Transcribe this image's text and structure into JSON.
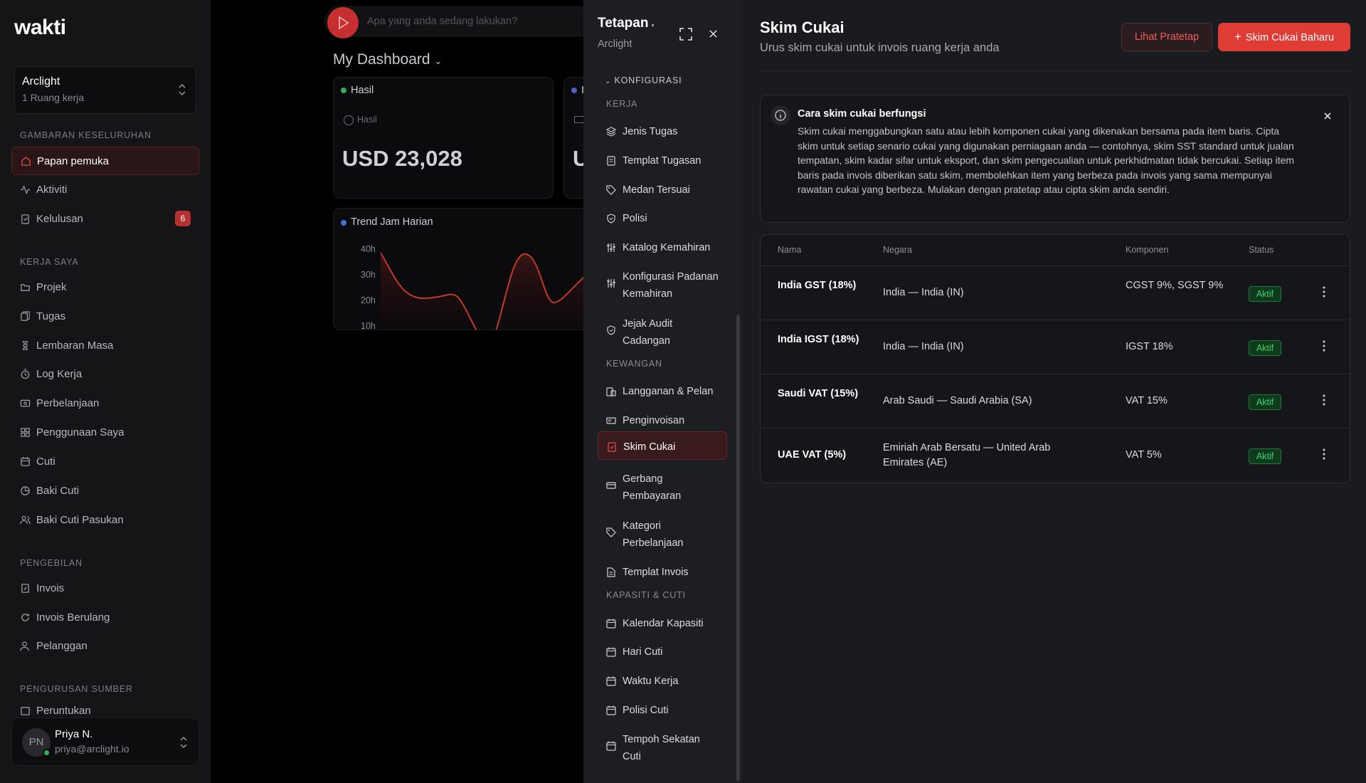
{
  "brand": {
    "logo": "wakti"
  },
  "workspace": {
    "name": "Arclight",
    "count": "1 Ruang kerja"
  },
  "sidebar": {
    "sections": [
      {
        "title": "GAMBARAN KESELURUHAN",
        "items": [
          {
            "label": "Papan pemuka",
            "icon": "home-icon",
            "active": true
          },
          {
            "label": "Aktiviti",
            "icon": "activity-icon"
          },
          {
            "label": "Kelulusan",
            "icon": "clipboard-icon",
            "badge": "6"
          }
        ]
      },
      {
        "title": "KERJA SAYA",
        "items": [
          {
            "label": "Projek",
            "icon": "folder-icon"
          },
          {
            "label": "Tugas",
            "icon": "checklist-icon"
          },
          {
            "label": "Lembaran Masa",
            "icon": "hourglass-icon"
          },
          {
            "label": "Log Kerja",
            "icon": "timer-icon"
          },
          {
            "label": "Perbelanjaan",
            "icon": "wallet-icon"
          },
          {
            "label": "Penggunaan Saya",
            "icon": "grid-icon"
          },
          {
            "label": "Cuti",
            "icon": "calendar-icon"
          },
          {
            "label": "Baki Cuti",
            "icon": "pie-icon"
          },
          {
            "label": "Baki Cuti Pasukan",
            "icon": "users-icon"
          }
        ]
      },
      {
        "title": "PENGEBILAN",
        "items": [
          {
            "label": "Invois",
            "icon": "invoice-icon"
          },
          {
            "label": "Invois Berulang",
            "icon": "repeat-icon"
          },
          {
            "label": "Pelanggan",
            "icon": "user-icon"
          }
        ]
      },
      {
        "title": "PENGURUSAN SUMBER",
        "items": [
          {
            "label": "Peruntukan",
            "icon": "allocation-icon"
          }
        ]
      }
    ]
  },
  "user": {
    "initials": "PN",
    "name": "Priya N.",
    "email": "priya@arclight.io"
  },
  "dashboard": {
    "search_placeholder": "Apa yang anda sedang lakukan?",
    "title": "My Dashboard",
    "card1": {
      "header": "Hasil",
      "sub": "Hasil",
      "value": "USD 23,028"
    },
    "card2": {
      "header": "I",
      "value": "U"
    },
    "trend": {
      "title": "Trend Jam Harian",
      "ticks": [
        "40h",
        "30h",
        "20h",
        "10h"
      ]
    }
  },
  "settings_nav": {
    "title": "Tetapan",
    "subtitle": "Arclight",
    "config_label": "KONFIGURASI",
    "groups": [
      {
        "title": "KERJA",
        "items": [
          {
            "label": "Jenis Tugas",
            "icon": "layers-icon"
          },
          {
            "label": "Templat Tugasan",
            "icon": "template-icon"
          },
          {
            "label": "Medan Tersuai",
            "icon": "tag-icon"
          },
          {
            "label": "Polisi",
            "icon": "shield-icon"
          },
          {
            "label": "Katalog Kemahiran",
            "icon": "sliders-icon"
          },
          {
            "label": "Konfigurasi Padanan Kemahiran",
            "icon": "sliders-icon"
          },
          {
            "label": "Jejak Audit Cadangan",
            "icon": "shield-check-icon"
          }
        ]
      },
      {
        "title": "KEWANGAN",
        "items": [
          {
            "label": "Langganan & Pelan",
            "icon": "subscription-icon"
          },
          {
            "label": "Penginvoisan",
            "icon": "invoice-icon"
          },
          {
            "label": "Skim Cukai",
            "icon": "tax-icon",
            "active": true
          },
          {
            "label": "Gerbang Pembayaran",
            "icon": "card-icon"
          },
          {
            "label": "Kategori Perbelanjaan",
            "icon": "tag-icon"
          },
          {
            "label": "Templat Invois",
            "icon": "document-icon"
          }
        ]
      },
      {
        "title": "KAPASITI & CUTI",
        "items": [
          {
            "label": "Kalendar Kapasiti",
            "icon": "calendar-icon"
          },
          {
            "label": "Hari Cuti",
            "icon": "calendar-icon"
          },
          {
            "label": "Waktu Kerja",
            "icon": "calendar-icon"
          },
          {
            "label": "Polisi Cuti",
            "icon": "calendar-icon"
          },
          {
            "label": "Tempoh Sekatan Cuti",
            "icon": "calendar-icon"
          }
        ]
      }
    ]
  },
  "main": {
    "title": "Skim Cukai",
    "subtitle": "Urus skim cukai untuk invois ruang kerja anda",
    "btn_presets": "Lihat Pratetap",
    "btn_new": "Skim Cukai Baharu",
    "info": {
      "title": "Cara skim cukai berfungsi",
      "body": "Skim cukai menggabungkan satu atau lebih komponen cukai yang dikenakan bersama pada item baris. Cipta skim untuk setiap senario cukai yang digunakan perniagaan anda — contohnya, skim SST standard untuk jualan tempatan, skim kadar sifar untuk eksport, dan skim pengecualian untuk perkhidmatan tidak bercukai. Setiap item baris pada invois diberikan satu skim, membolehkan item yang berbeza pada invois yang sama mempunyai rawatan cukai yang berbeza. Mulakan dengan pratetap atau cipta skim anda sendiri."
    },
    "table": {
      "headers": [
        "Nama",
        "Negara",
        "Komponen",
        "Status"
      ],
      "rows": [
        {
          "name": "India GST (18%)",
          "country": "India — India (IN)",
          "components": "CGST 9%, SGST 9%",
          "status": "Aktif"
        },
        {
          "name": "India IGST (18%)",
          "country": "India — India (IN)",
          "components": "IGST 18%",
          "status": "Aktif"
        },
        {
          "name": "Saudi VAT (15%)",
          "country": "Arab Saudi — Saudi Arabia (SA)",
          "components": "VAT 15%",
          "status": "Aktif"
        },
        {
          "name": "UAE VAT (5%)",
          "country": "Emiriah Arab Bersatu — United Arab Emirates (AE)",
          "components": "VAT 5%",
          "status": "Aktif"
        }
      ]
    }
  }
}
